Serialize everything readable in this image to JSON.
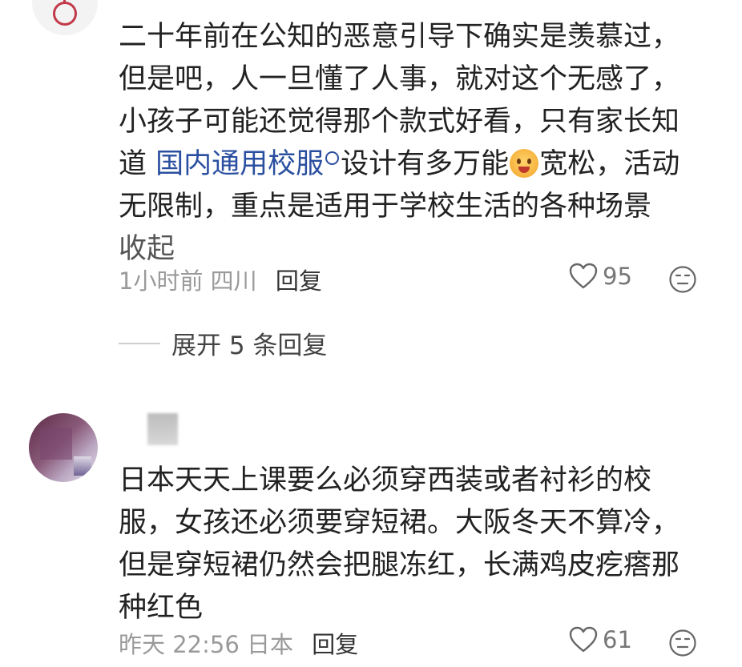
{
  "comment1": {
    "lines": [
      "二十年前在公知的恶意引导下确实是羡慕过，",
      "但是吧，人一旦懂了人事，就对这个无感了，",
      "小孩子可能还觉得那个款式好看，只有家长知"
    ],
    "line4_prefix": "道",
    "link_text": "国内通用校服",
    "line4_suffix_a": "设计有多万能",
    "line4_suffix_b": "宽松，活动",
    "line5": "无限制，重点是适用于学校生活的各种场景",
    "collapse": "收起",
    "time": "1小时前",
    "location": "四川",
    "reply": "回复",
    "likes": "95"
  },
  "expand_replies": "展开 5 条回复",
  "comment2": {
    "lines": [
      "日本天天上课要么必须穿西装或者衬衫的校",
      "服，女孩还必须要穿短裙。大阪冬天不算冷，",
      "但是穿短裙仍然会把腿冻红，长满鸡皮疙瘩那",
      "种红色"
    ],
    "time": "昨天 22:56",
    "location": "日本",
    "reply": "回复",
    "likes": "61"
  },
  "icons": {
    "like": "heart-outline-icon",
    "react": "emoji-face-icon",
    "link": "search-icon",
    "emoji": "crying-emoji"
  },
  "colors": {
    "link": "#2b4fa0",
    "meta": "#9a9a9a",
    "text": "#222222"
  }
}
